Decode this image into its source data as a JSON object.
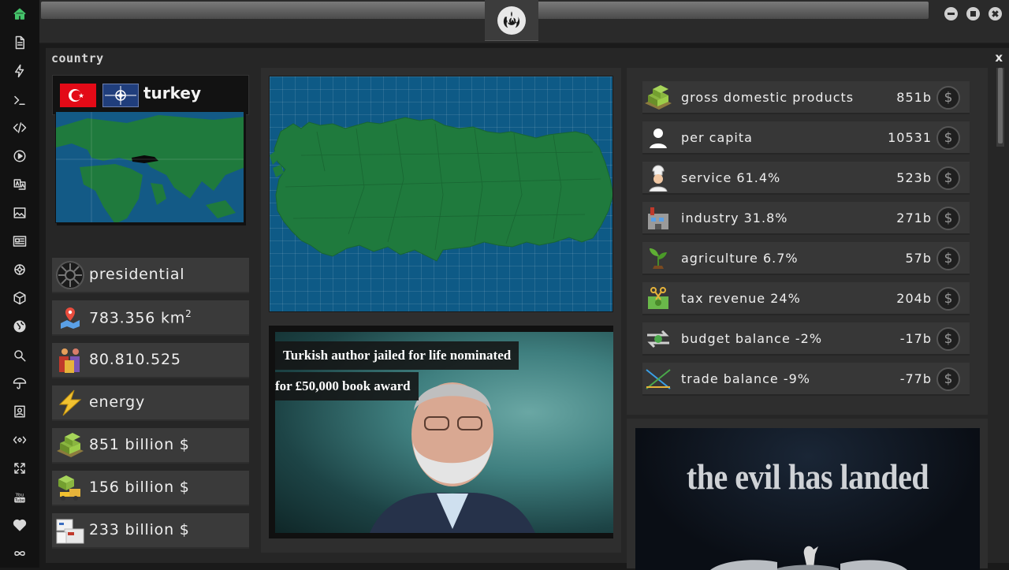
{
  "app": {
    "logo_icon": "rebel-alliance-icon",
    "accent_color": "#45c46a"
  },
  "rail": {
    "icons": [
      "home-icon",
      "document-icon",
      "bolt-icon",
      "terminal-icon",
      "code-icon",
      "play-icon",
      "translate-icon",
      "image-icon",
      "news-icon",
      "gear-icon",
      "hexagon-icon",
      "globe-icon",
      "search-icon",
      "umbrella-icon",
      "contacts-icon",
      "tags-icon",
      "expand-icon",
      "youtube-icon",
      "heart-icon",
      "infinity-icon"
    ]
  },
  "panel": {
    "title": "country",
    "close_label": "x"
  },
  "country": {
    "name": "turkey",
    "flags": [
      "turkey-flag",
      "nato-flag"
    ]
  },
  "stats": [
    {
      "icon": "empire-icon",
      "text": "presidential"
    },
    {
      "icon": "map-pin-icon",
      "text": "783.356 km",
      "sup": "2"
    },
    {
      "icon": "population-icon",
      "text": "80.810.525"
    },
    {
      "icon": "lightning-icon",
      "text": "energy"
    },
    {
      "icon": "money-stack-icon",
      "text": "851 billion $"
    },
    {
      "icon": "forklift-icon",
      "text": "156 billion $"
    },
    {
      "icon": "boxes-icon",
      "text": "233 billion $"
    }
  ],
  "news": {
    "headline_line1": "Turkish author jailed for life nominated",
    "headline_line2": "for £50,000 book award"
  },
  "economy": {
    "currency_symbol": "$",
    "rows": [
      {
        "icon": "money-stack-icon",
        "label": "gross domestic products",
        "value": "851b"
      },
      {
        "icon": "person-icon",
        "label": "per capita",
        "value": "10531"
      },
      {
        "icon": "chef-icon",
        "label": "service 61.4%",
        "value": "523b"
      },
      {
        "icon": "factory-icon",
        "label": "industry 31.8%",
        "value": "271b"
      },
      {
        "icon": "plant-icon",
        "label": "agriculture 6.7%",
        "value": "57b"
      },
      {
        "icon": "tax-scissors-icon",
        "label": "tax revenue 24%",
        "value": "204b"
      },
      {
        "icon": "balance-arrows-icon",
        "label": "budget balance -2%",
        "value": "-17b"
      },
      {
        "icon": "trade-cross-icon",
        "label": "trade balance -9%",
        "value": "-77b"
      }
    ]
  },
  "promo": {
    "title": "the evil has landed"
  }
}
